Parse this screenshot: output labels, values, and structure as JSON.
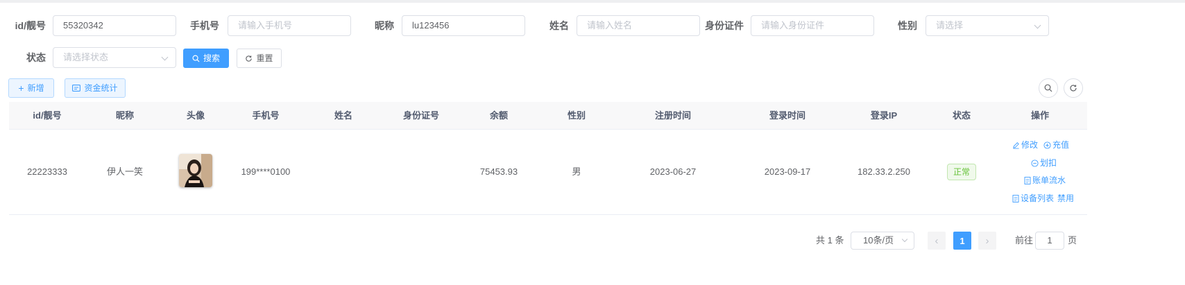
{
  "search": {
    "id_label": "id/靓号",
    "id_value": "55320342",
    "phone_label": "手机号",
    "phone_placeholder": "请输入手机号",
    "nickname_label": "昵称",
    "nickname_value": "lu123456",
    "name_label": "姓名",
    "name_placeholder": "请输入姓名",
    "idcard_label": "身份证件",
    "idcard_placeholder": "请输入身份证件",
    "gender_label": "性别",
    "gender_placeholder": "请选择",
    "status_label": "状态",
    "status_placeholder": "请选择状态",
    "search_button": "搜索",
    "reset_button": "重置"
  },
  "toolbar": {
    "add_button": "新增",
    "funds_button": "资金统计"
  },
  "table": {
    "headers": [
      "id/靓号",
      "昵称",
      "头像",
      "手机号",
      "姓名",
      "身份证号",
      "余额",
      "性别",
      "注册时间",
      "登录时间",
      "登录IP",
      "状态",
      "操作"
    ],
    "rows": [
      {
        "id": "22223333",
        "nickname": "伊人一笑",
        "phone": "199****0100",
        "name": "",
        "idcard": "",
        "balance": "75453.93",
        "gender": "男",
        "register_time": "2023-06-27",
        "login_time": "2023-09-17",
        "login_ip": "182.33.2.250",
        "status": "正常",
        "actions": {
          "edit": "修改",
          "recharge": "充值",
          "deduct": "划扣",
          "bill": "账单流水",
          "devices": "设备列表",
          "disable": "禁用"
        }
      }
    ]
  },
  "pagination": {
    "total": "共 1 条",
    "page_size": "10条/页",
    "current_page": "1",
    "goto_label": "前往",
    "goto_value": "1",
    "page_suffix": "页"
  },
  "colors": {
    "primary": "#409eff",
    "success": "#67c23a"
  }
}
